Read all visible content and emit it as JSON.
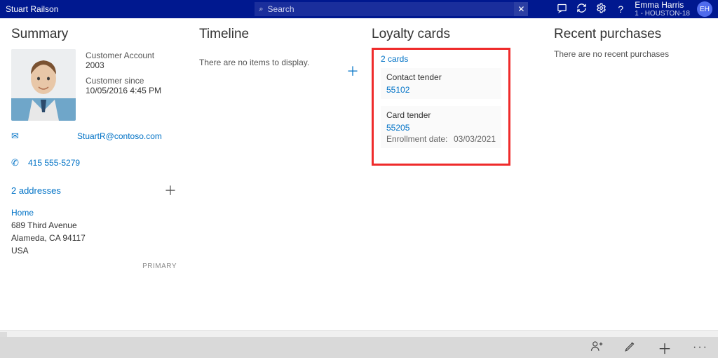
{
  "header": {
    "customer_name": "Stuart Railson",
    "search_placeholder": "Search",
    "user_name": "Emma Harris",
    "user_location": "1 - HOUSTON-18",
    "user_initials": "EH"
  },
  "summary": {
    "title": "Summary",
    "account_label": "Customer Account",
    "account_value": "2003",
    "since_label": "Customer since",
    "since_value": "10/05/2016 4:45 PM",
    "email": "StuartR@contoso.com",
    "phone": "415 555-5279",
    "addresses_link": "2 addresses",
    "address": {
      "label": "Home",
      "line1": "689 Third Avenue",
      "line2": "Alameda, CA 94117",
      "line3": "USA",
      "badge": "PRIMARY"
    }
  },
  "timeline": {
    "title": "Timeline",
    "empty": "There are no items to display."
  },
  "loyalty": {
    "title": "Loyalty cards",
    "count_label": "2 cards",
    "cards": [
      {
        "title": "Contact tender",
        "number": "55102"
      },
      {
        "title": "Card tender",
        "number": "55205",
        "enroll_label": "Enrollment date:",
        "enroll_date": "03/03/2021"
      }
    ]
  },
  "recent": {
    "title": "Recent purchases",
    "empty": "There are no recent purchases"
  }
}
